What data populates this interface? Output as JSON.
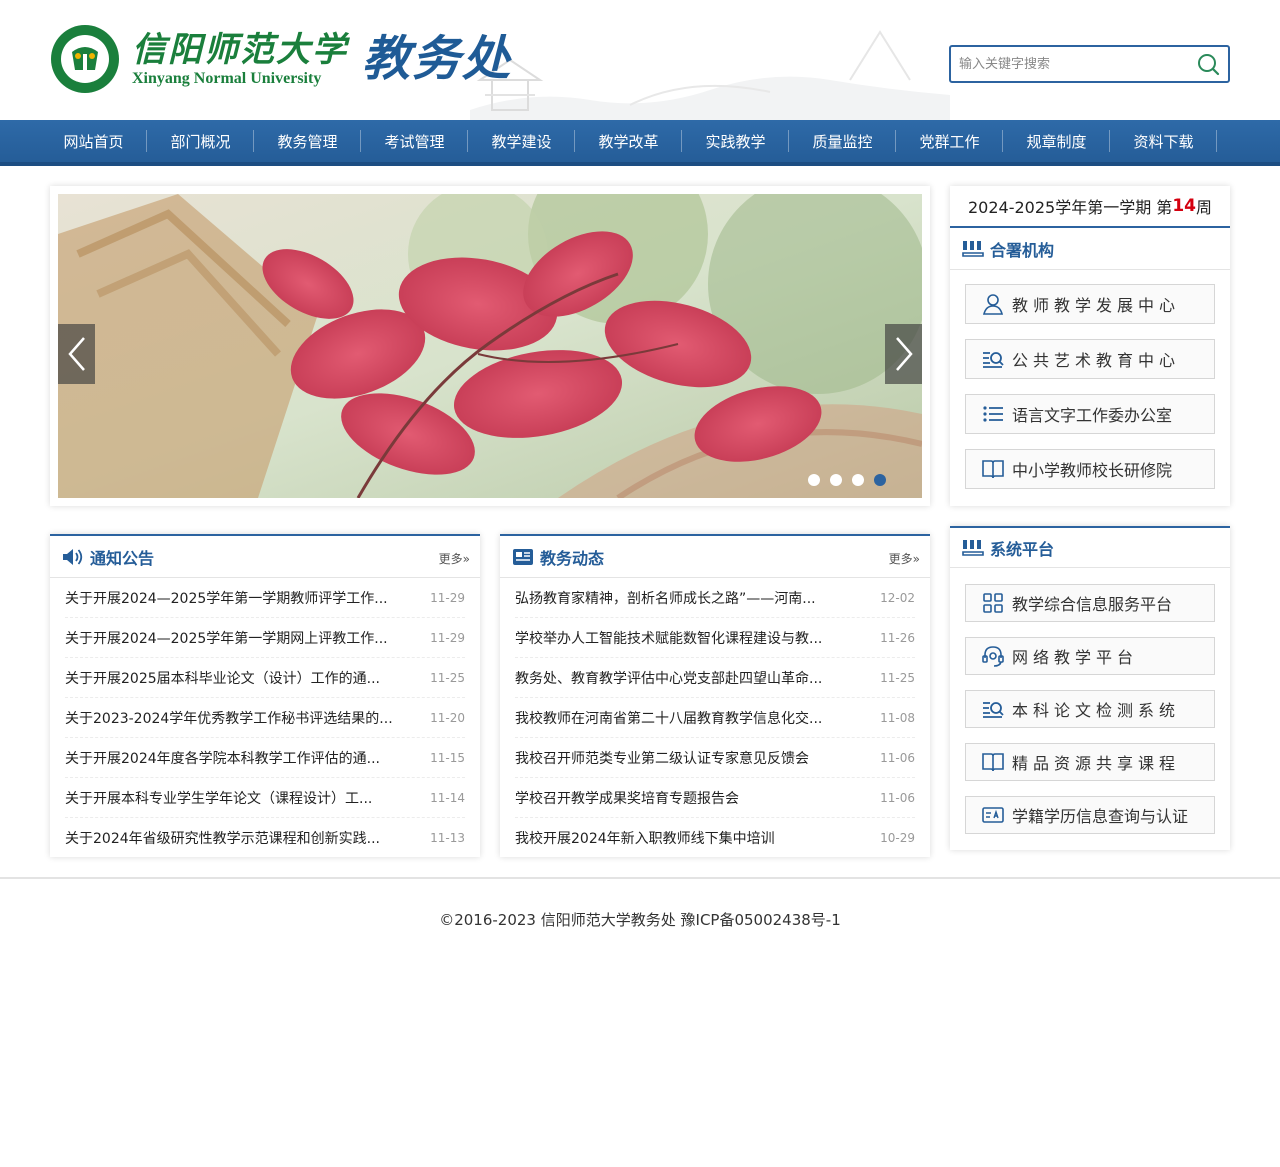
{
  "header": {
    "university_cn": "信阳师范大学",
    "university_en": "Xinyang Normal University",
    "department": "教务处",
    "search_placeholder": "输入关键字搜索",
    "brand_green": "#1a7f3c",
    "brand_blue": "#1f5b96"
  },
  "nav": {
    "items": [
      "网站首页",
      "部门概况",
      "教务管理",
      "考试管理",
      "教学建设",
      "教学改革",
      "实践教学",
      "质量监控",
      "党群工作",
      "规章制度",
      "资料下载"
    ]
  },
  "slider": {
    "slide_count": 4,
    "active_slide": 4
  },
  "week": {
    "prefix": "2024-2025学年第一学期 第",
    "number": "14",
    "suffix": "周"
  },
  "orgs": {
    "title": "合署机构",
    "items": [
      {
        "label": "教师教学发展中心",
        "icon": "user-icon"
      },
      {
        "label": "公共艺术教育中心",
        "icon": "list-search-icon"
      },
      {
        "label": "语言文字工作委办公室",
        "icon": "list-icon"
      },
      {
        "label": "中小学教师校长研修院",
        "icon": "book-icon"
      }
    ]
  },
  "platforms": {
    "title": "系统平台",
    "items": [
      {
        "label": "教学综合信息服务平台",
        "icon": "grid-icon"
      },
      {
        "label": "网络教学平台",
        "icon": "headset-icon"
      },
      {
        "label": "本科论文检测系统",
        "icon": "list-search-icon"
      },
      {
        "label": "精品资源共享课程",
        "icon": "book-icon"
      },
      {
        "label": "学籍学历信息查询与认证",
        "icon": "id-card-icon"
      }
    ]
  },
  "notices": {
    "title": "通知公告",
    "more": "更多»",
    "items": [
      {
        "title": "关于开展2024—2025学年第一学期教师评学工作...",
        "date": "11-29"
      },
      {
        "title": "关于开展2024—2025学年第一学期网上评教工作...",
        "date": "11-29"
      },
      {
        "title": "关于开展2025届本科毕业论文（设计）工作的通...",
        "date": "11-25"
      },
      {
        "title": "关于2023-2024学年优秀教学工作秘书评选结果的...",
        "date": "11-20"
      },
      {
        "title": "关于开展2024年度各学院本科教学工作评估的通...",
        "date": "11-15"
      },
      {
        "title": "关于开展本科专业学生学年论文（课程设计）工...",
        "date": "11-14"
      },
      {
        "title": "关于2024年省级研究性教学示范课程和创新实践...",
        "date": "11-13"
      }
    ]
  },
  "news": {
    "title": "教务动态",
    "more": "更多»",
    "items": [
      {
        "title": "弘扬教育家精神，剖析名师成长之路”——河南...",
        "date": "12-02"
      },
      {
        "title": "学校举办人工智能技术赋能数智化课程建设与教...",
        "date": "11-26"
      },
      {
        "title": "教务处、教育教学评估中心党支部赴四望山革命...",
        "date": "11-25"
      },
      {
        "title": "我校教师在河南省第二十八届教育教学信息化交...",
        "date": "11-08"
      },
      {
        "title": "我校召开师范类专业第二级认证专家意见反馈会",
        "date": "11-06"
      },
      {
        "title": "学校召开教学成果奖培育专题报告会",
        "date": "11-06"
      },
      {
        "title": "我校开展2024年新入职教师线下集中培训",
        "date": "10-29"
      }
    ]
  },
  "footer": {
    "text": "©2016-2023 信阳师范大学教务处 豫ICP备05002438号-1"
  }
}
